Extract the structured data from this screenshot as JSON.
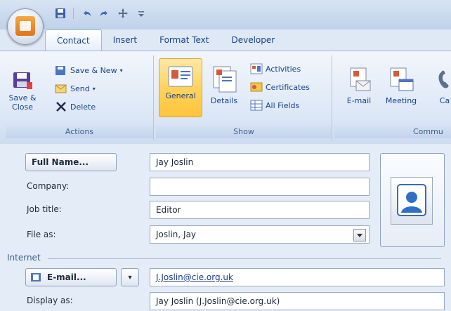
{
  "tabs": [
    {
      "label": "Contact",
      "active": true
    },
    {
      "label": "Insert"
    },
    {
      "label": "Format Text"
    },
    {
      "label": "Developer"
    }
  ],
  "ribbon": {
    "actions": {
      "label": "Actions",
      "save_close_line1": "Save &",
      "save_close_line2": "Close",
      "save_new": "Save & New",
      "send": "Send",
      "delete": "Delete"
    },
    "show": {
      "label": "Show",
      "general": "General",
      "details": "Details",
      "activities": "Activities",
      "certificates": "Certificates",
      "all_fields": "All Fields"
    },
    "communicate": {
      "label": "Commu",
      "email": "E-mail",
      "meeting": "Meeting",
      "call": "Ca"
    }
  },
  "form": {
    "full_name_button": "Full Name...",
    "full_name_value": "Jay Joslin",
    "company_label": "Company:",
    "company_value": "",
    "job_title_label": "Job title:",
    "job_title_value": "Editor",
    "file_as_label": "File as:",
    "file_as_value": "Joslin, Jay",
    "internet_label": "Internet",
    "email_button": "E-mail...",
    "email_value": "J.Joslin@cie.org.uk",
    "display_as_label": "Display as:",
    "display_as_value": "Jay Joslin (J.Joslin@cie.org.uk)"
  },
  "icons": {
    "office": "office-button-icon",
    "save": "save-icon",
    "undo": "undo-icon",
    "redo": "redo-icon",
    "contact_photo": "contact-card-icon"
  }
}
